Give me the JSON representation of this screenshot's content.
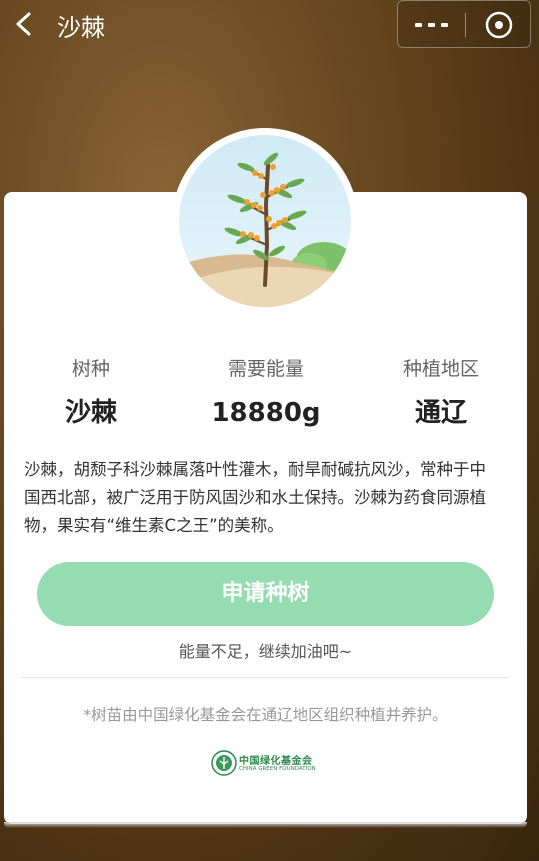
{
  "header": {
    "title": "沙棘",
    "back_icon": "chevron-left-icon",
    "more_icon": "more-dots-icon",
    "close_icon": "close-target-icon"
  },
  "tree": {
    "image_icon": "sea-buckthorn-tree-illustration"
  },
  "stats": [
    {
      "label": "树种",
      "value": "沙棘"
    },
    {
      "label": "需要能量",
      "value": "18880g"
    },
    {
      "label": "种植地区",
      "value": "通辽"
    }
  ],
  "description": "沙棘，胡颓子科沙棘属落叶性灌木，耐旱耐碱抗风沙，常种于中国西北部，被广泛用于防风固沙和水土保持。沙棘为药食同源植物，果实有“维生素C之王”的美称。",
  "apply_button": "申请种树",
  "hint": "能量不足，继续加油吧~",
  "note": "*树苗由中国绿化基金会在通辽地区组织种植并养护。",
  "foundation": {
    "name_cn": "中国绿化基金会",
    "name_en": "CHINA GREEN FOUNDATION"
  },
  "colors": {
    "button": "#95dcb2",
    "background": "#6b4a22"
  }
}
